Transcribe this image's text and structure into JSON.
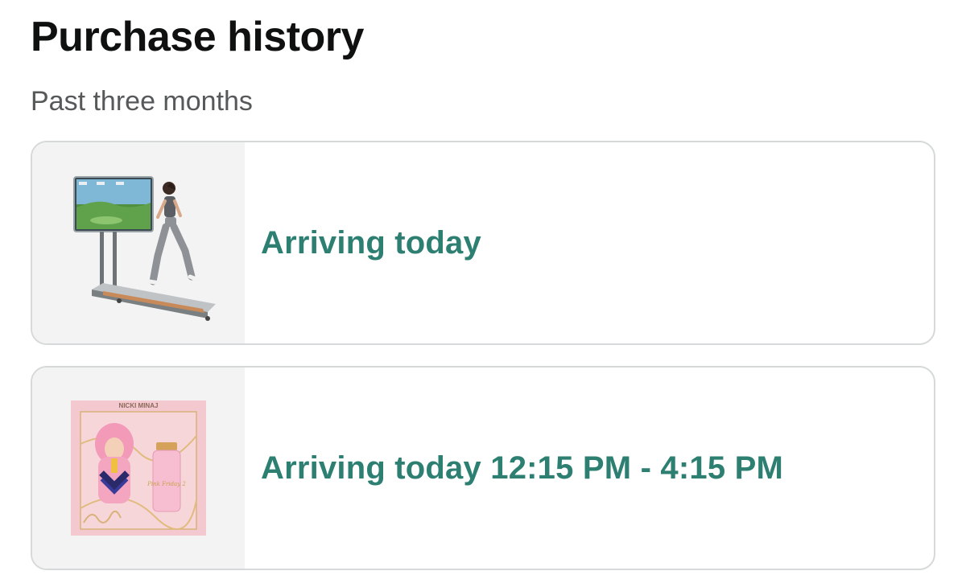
{
  "header": {
    "title": "Purchase history",
    "subtitle": "Past three months"
  },
  "orders": [
    {
      "status": "Arriving today",
      "image_icon": "treadmill-product-image",
      "status_color": "#2d7f72"
    },
    {
      "status": "Arriving today 12:15 PM - 4:15 PM",
      "image_icon": "perfume-gift-set-image",
      "status_color": "#2d7f72",
      "product_image_text": {
        "brand": "NICKI MINAJ",
        "name": "Pink Friday 2"
      }
    }
  ],
  "colors": {
    "status_green": "#2d7f72",
    "card_border": "#d5d9d9",
    "thumb_background": "#f3f3f3",
    "subtitle_gray": "#565959"
  }
}
